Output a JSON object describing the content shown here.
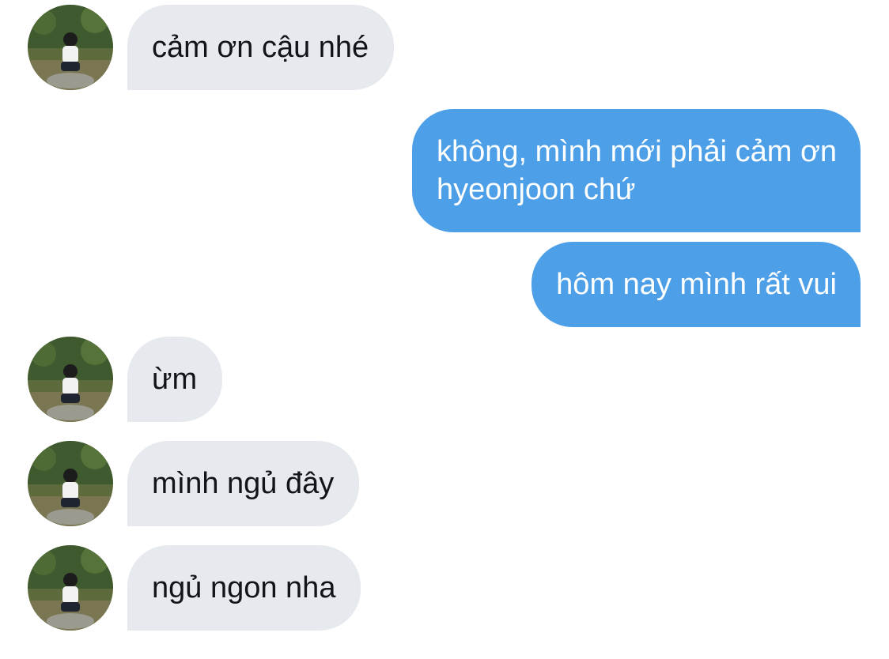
{
  "conversation": {
    "messages": [
      {
        "side": "incoming",
        "text": "cảm ơn cậu nhé"
      },
      {
        "side": "outgoing",
        "line1": "không, mình mới phải cảm ơn",
        "line2": "hyeonjoon chứ"
      },
      {
        "side": "outgoing",
        "text": "hôm nay mình rất vui"
      },
      {
        "side": "incoming",
        "text": "ừm"
      },
      {
        "side": "incoming",
        "text": "mình ngủ đây"
      },
      {
        "side": "incoming",
        "text": "ngủ ngon nha"
      }
    ]
  },
  "colors": {
    "incoming_bubble": "#e6e9ed",
    "outgoing_bubble": "#4d9fe8",
    "incoming_text": "#111418",
    "outgoing_text": "#ffffff"
  },
  "icons": {
    "contact_avatar": "avatar-photo-person-sitting-outdoors"
  }
}
